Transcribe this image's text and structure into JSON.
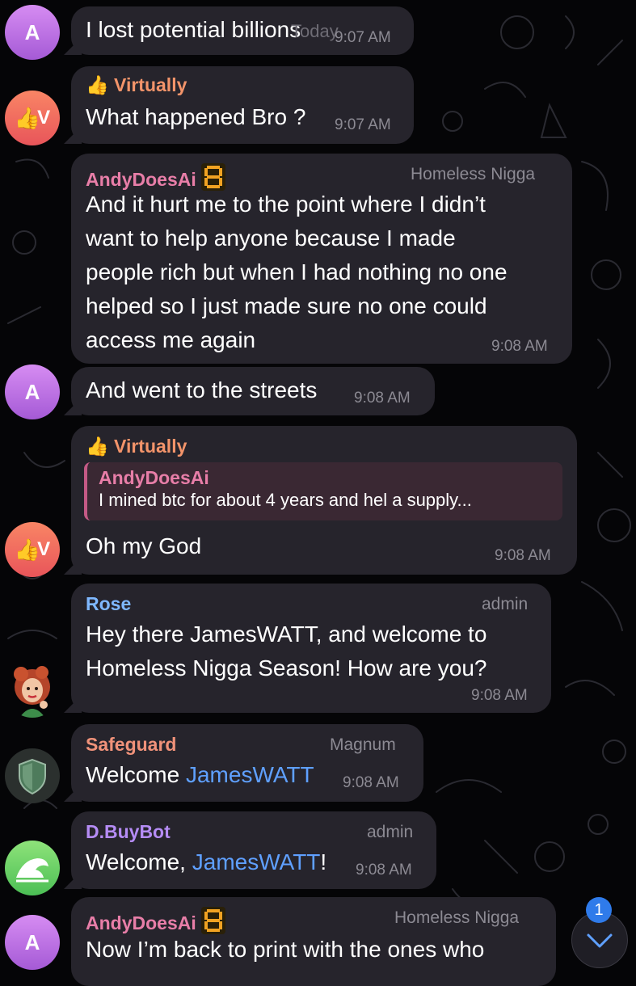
{
  "messages": [
    {
      "avatar": "A",
      "text": "I lost potential billions",
      "date_overlay": "Today",
      "time": "9:07 AM"
    },
    {
      "sender": "Virtually",
      "sender_emoji": "👍",
      "avatar": "V",
      "text": "What happened Bro ?",
      "time": "9:07 AM"
    },
    {
      "sender": "AndyDoesAi",
      "role": "Homeless Nigga",
      "lines": [
        "And it hurt me to the point where I didn’t",
        "want to help anyone because I made",
        "people rich but when I had nothing no one",
        "helped so I just made sure no one could",
        "access me again"
      ],
      "time": "9:08 AM"
    },
    {
      "avatar": "A",
      "text": "And went to the streets",
      "time": "9:08 AM"
    },
    {
      "sender": "Virtually",
      "sender_emoji": "👍",
      "avatar": "V",
      "reply_to": {
        "sender": "AndyDoesAi",
        "text": "I mined btc for about 4 years and hel a supply..."
      },
      "text": "Oh my God",
      "time": "9:08 AM"
    },
    {
      "sender": "Rose",
      "role": "admin",
      "lines": [
        "Hey there JamesWATT, and welcome to",
        "Homeless Nigga Season! How are you?"
      ],
      "time": "9:08 AM"
    },
    {
      "sender": "Safeguard",
      "role": "Magnum",
      "text_prefix": "Welcome ",
      "mention": "JamesWATT",
      "time": "9:08 AM"
    },
    {
      "sender": "D.BuyBot",
      "role": "admin",
      "text_prefix": "Welcome, ",
      "mention": "JamesWATT",
      "text_suffix": "!",
      "time": "9:08 AM"
    },
    {
      "sender": "AndyDoesAi",
      "role": "Homeless Nigga",
      "avatar": "A",
      "text": "Now I’m back to print with the ones who"
    }
  ],
  "scroll_button": {
    "icon": "chevron-down-icon",
    "unread_count": "1"
  },
  "colors": {
    "bubble": "#26242c",
    "background": "#050507",
    "virtually": "#f3946a",
    "andy": "#e87ea8",
    "rose": "#7fb8ff",
    "safeguard": "#f0927a",
    "buybot": "#b58cf5",
    "mention": "#5fa0ff",
    "meta": "#8c8a93"
  }
}
